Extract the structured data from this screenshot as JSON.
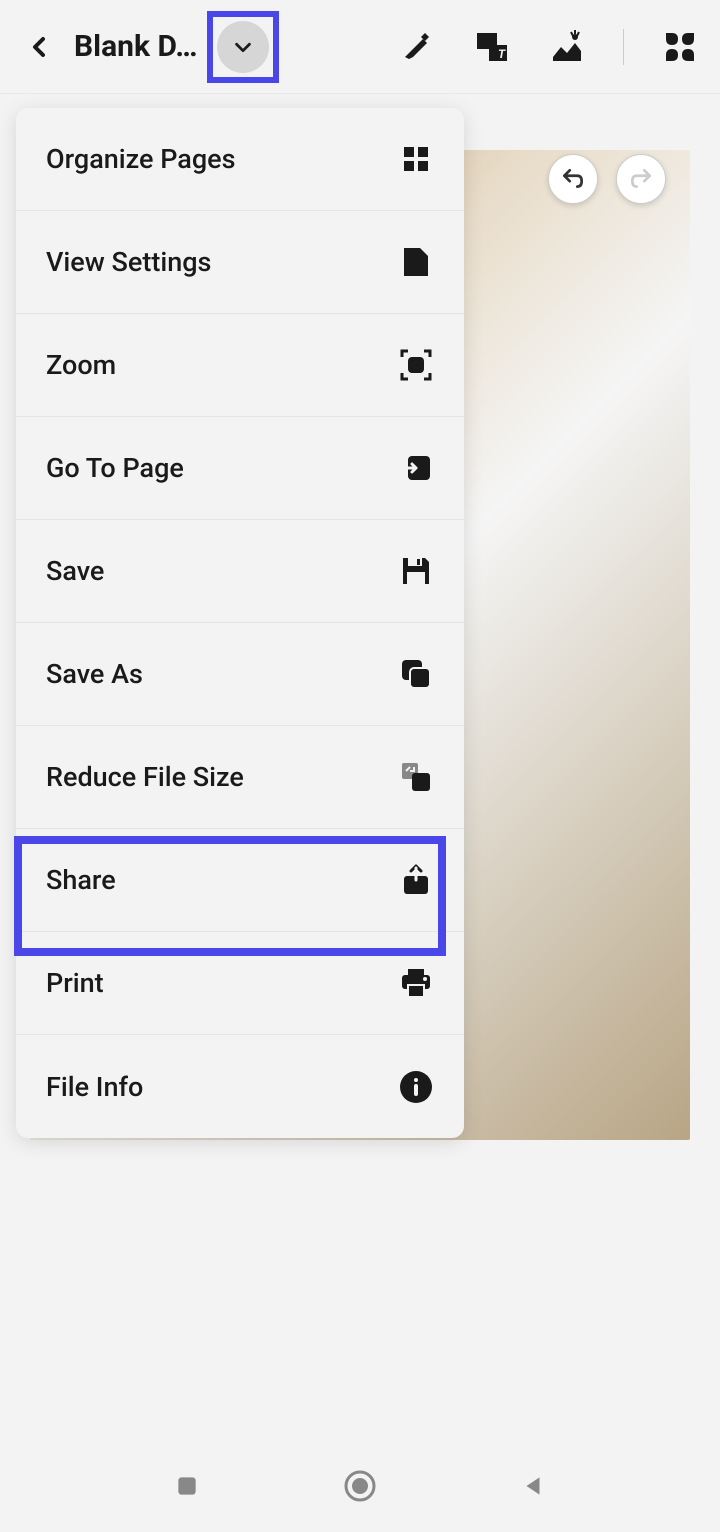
{
  "header": {
    "title": "Blank D…"
  },
  "menu": {
    "items": [
      {
        "label": "Organize Pages",
        "icon": "grid-icon"
      },
      {
        "label": "View Settings",
        "icon": "page-icon"
      },
      {
        "label": "Zoom",
        "icon": "zoom-icon"
      },
      {
        "label": "Go To Page",
        "icon": "goto-icon"
      },
      {
        "label": "Save",
        "icon": "save-icon"
      },
      {
        "label": "Save As",
        "icon": "copy-icon"
      },
      {
        "label": "Reduce File Size",
        "icon": "reduce-icon"
      },
      {
        "label": "Share",
        "icon": "share-icon"
      },
      {
        "label": "Print",
        "icon": "print-icon"
      },
      {
        "label": "File Info",
        "icon": "info-icon"
      }
    ]
  }
}
